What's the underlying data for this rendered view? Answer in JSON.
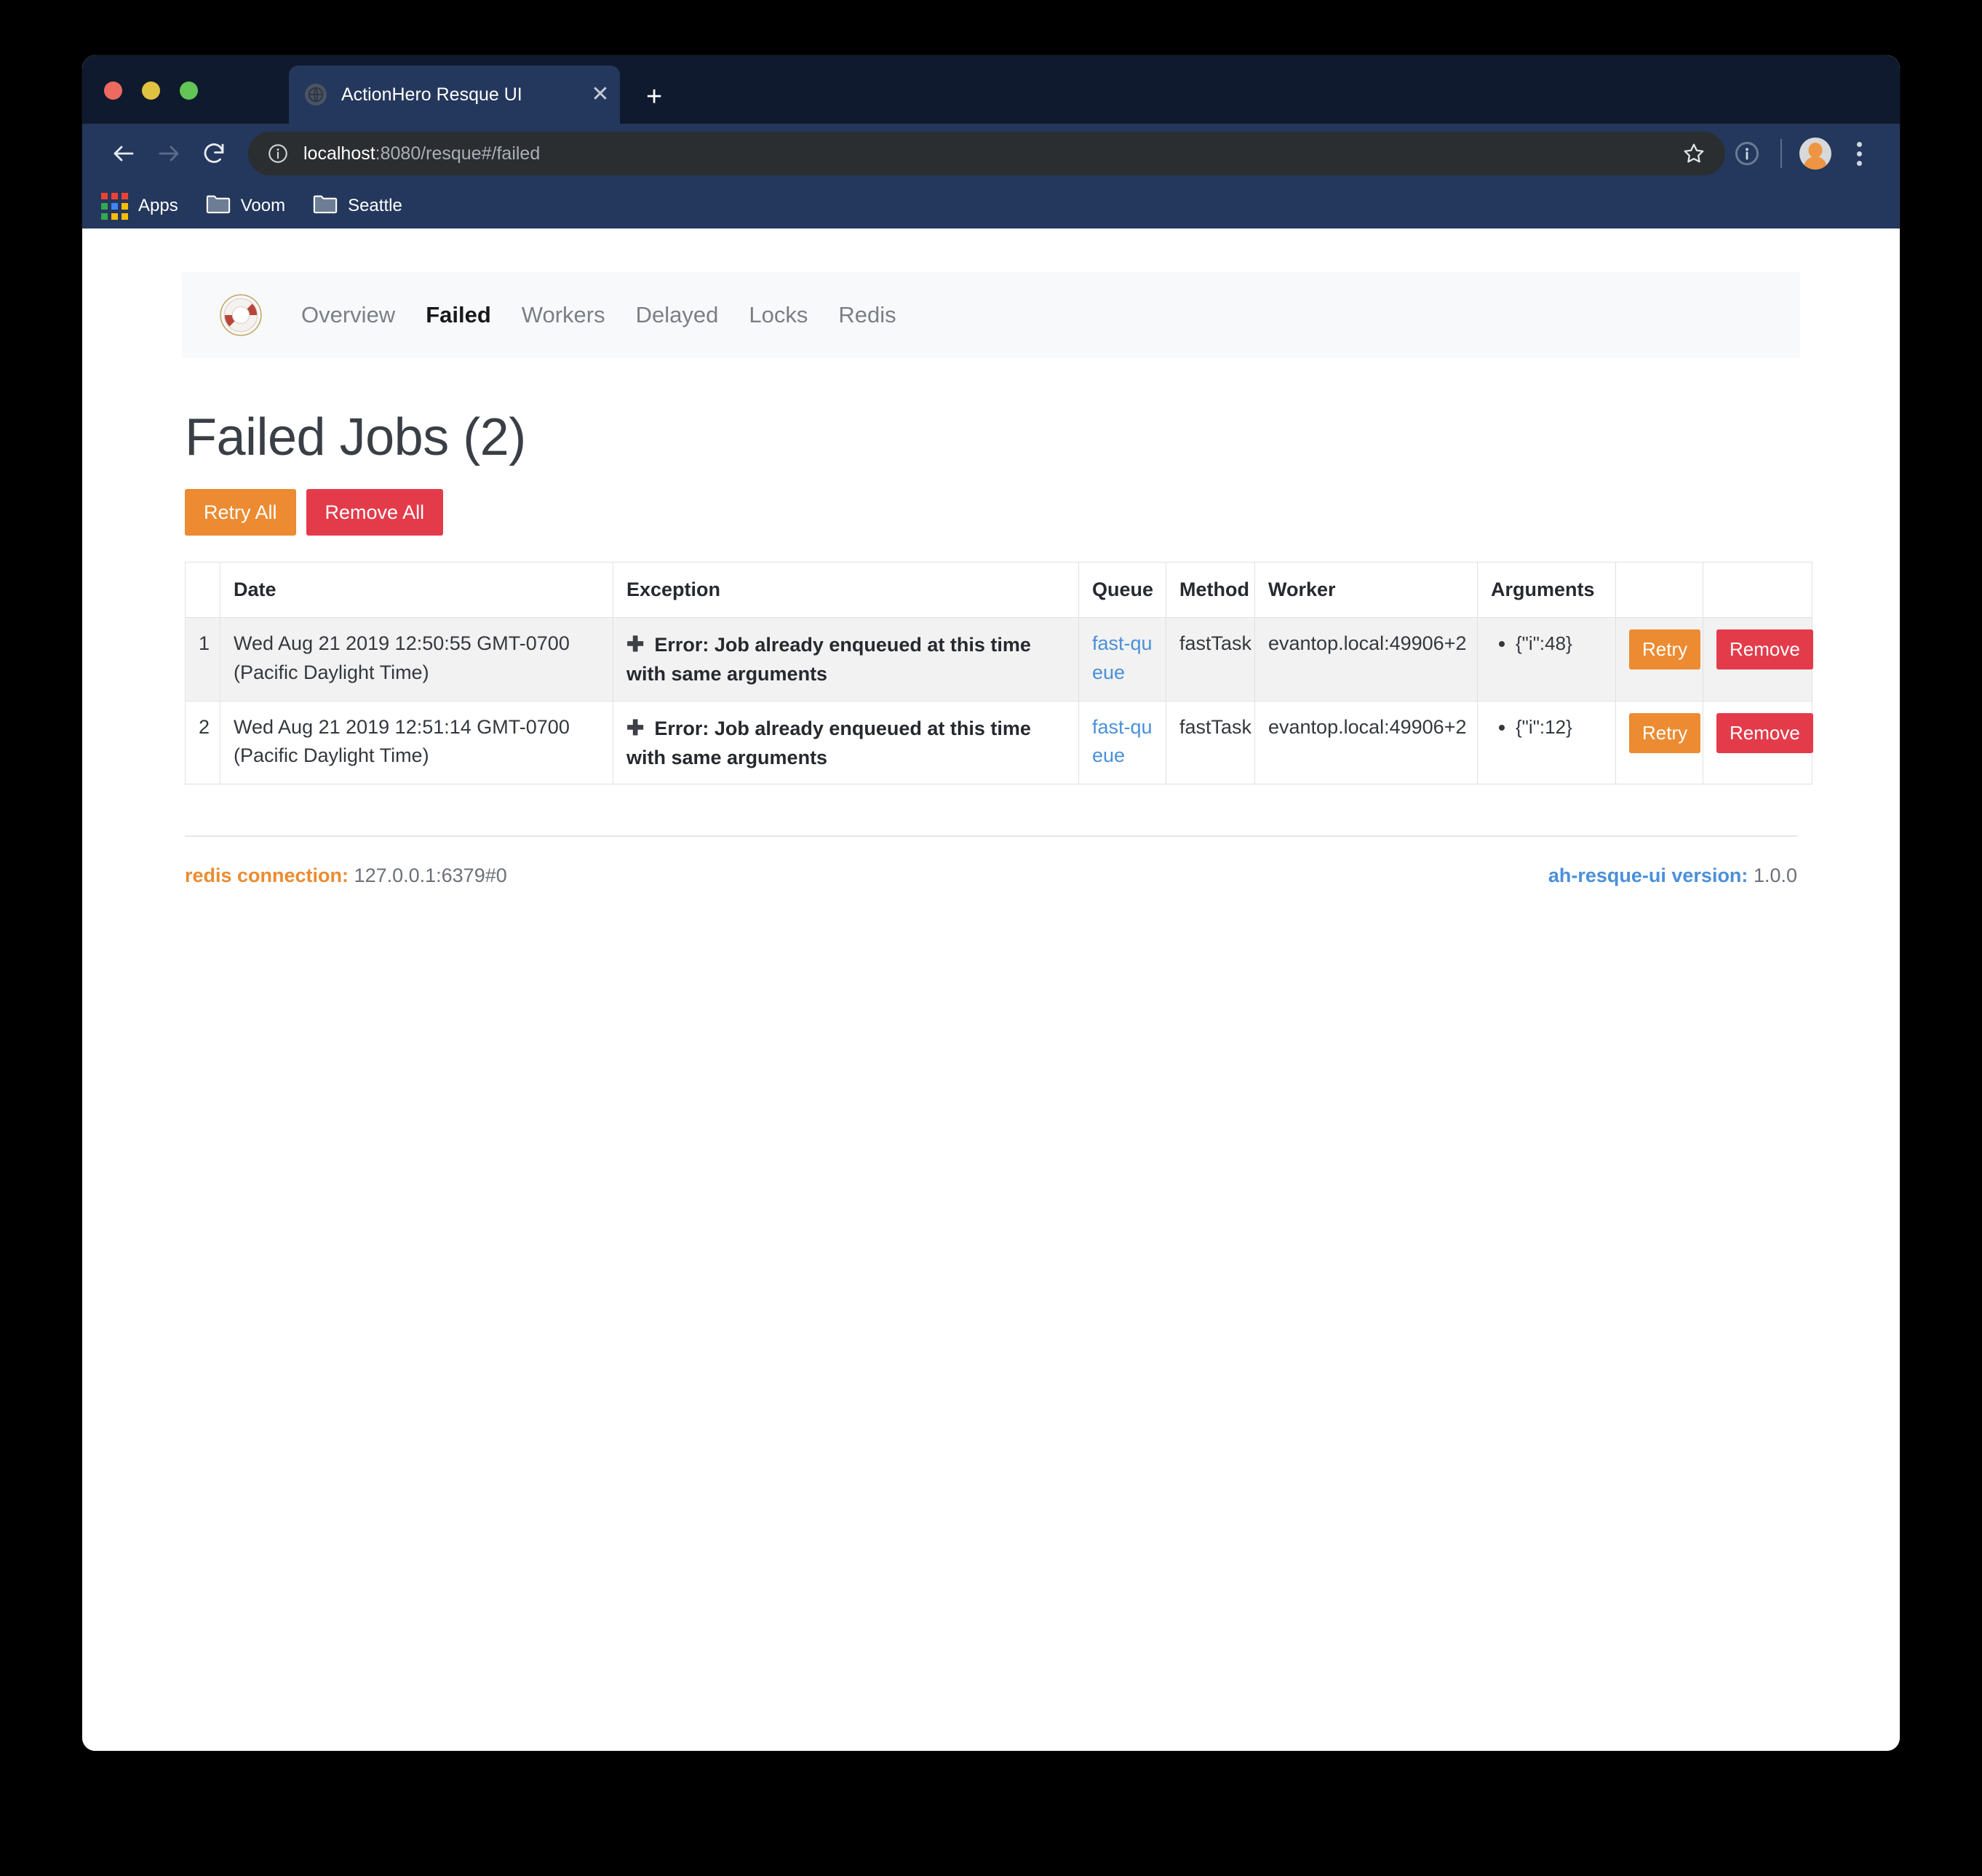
{
  "browser": {
    "tab": {
      "title": "ActionHero Resque UI",
      "favicon_icon": "globe-icon",
      "close_icon": "close-icon"
    },
    "new_tab_icon": "plus-icon",
    "nav": {
      "back_icon": "arrow-left-icon",
      "forward_icon": "arrow-right-icon",
      "reload_icon": "reload-icon"
    },
    "omnibox": {
      "info_icon": "info-circle-icon",
      "url_host": "localhost",
      "url_rest": ":8080/resque#/failed",
      "star_icon": "star-icon"
    },
    "toolbar_right": {
      "extension_icon": "extension-circle-icon",
      "avatar_icon": "avatar-icon",
      "menu_icon": "kebab-menu-icon"
    },
    "bookmarks": [
      {
        "label": "Apps",
        "icon": "apps-grid-icon"
      },
      {
        "label": "Voom",
        "icon": "folder-icon"
      },
      {
        "label": "Seattle",
        "icon": "folder-icon"
      }
    ]
  },
  "app": {
    "logo_icon": "lifebuoy-icon",
    "nav_items": [
      {
        "label": "Overview",
        "active": false
      },
      {
        "label": "Failed",
        "active": true
      },
      {
        "label": "Workers",
        "active": false
      },
      {
        "label": "Delayed",
        "active": false
      },
      {
        "label": "Locks",
        "active": false
      },
      {
        "label": "Redis",
        "active": false
      }
    ],
    "page_title": "Failed Jobs (2)",
    "buttons": {
      "retry_all": "Retry All",
      "remove_all": "Remove All"
    },
    "table": {
      "headers": [
        "",
        "Date",
        "Exception",
        "Queue",
        "Method",
        "Worker",
        "Arguments",
        "",
        ""
      ],
      "rows": [
        {
          "index": "1",
          "date": "Wed Aug 21 2019 12:50:55 GMT-0700 (Pacific Daylight Time)",
          "exception_expand_icon": "plus-icon",
          "exception": "Error: Job already enqueued at this time with same arguments",
          "queue": "fast-queue",
          "method": "fastTask",
          "worker": "evantop.local:49906+2",
          "arguments": [
            "{\"i\":48}"
          ],
          "retry_label": "Retry",
          "remove_label": "Remove"
        },
        {
          "index": "2",
          "date": "Wed Aug 21 2019 12:51:14 GMT-0700 (Pacific Daylight Time)",
          "exception_expand_icon": "plus-icon",
          "exception": "Error: Job already enqueued at this time with same arguments",
          "queue": "fast-queue",
          "method": "fastTask",
          "worker": "evantop.local:49906+2",
          "arguments": [
            "{\"i\":12}"
          ],
          "retry_label": "Retry",
          "remove_label": "Remove"
        }
      ]
    },
    "footer": {
      "redis_label": "redis connection:",
      "redis_value": "127.0.0.1:6379#0",
      "version_label": "ah-resque-ui version:",
      "version_value": "1.0.0"
    }
  },
  "colors": {
    "accent_orange": "#ec8b31",
    "danger_red": "#e43b4a",
    "link_blue": "#4a90d9",
    "chrome_tabstrip": "#101a2e",
    "chrome_toolbar": "#24375c",
    "omnibox_bg": "#2b2e31",
    "nav_bg": "#f7f9fa"
  }
}
